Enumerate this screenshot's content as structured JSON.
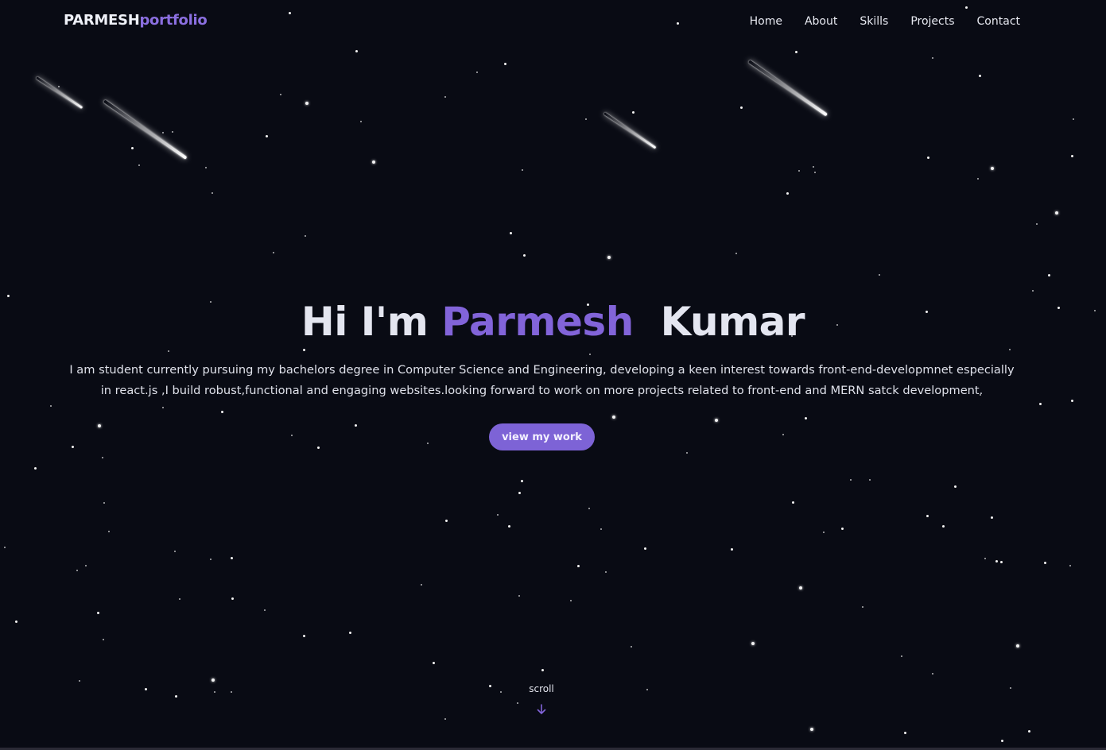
{
  "brand": {
    "part1": "PARMESH",
    "part2": "portfolio"
  },
  "nav": {
    "items": [
      {
        "label": "Home"
      },
      {
        "label": "About"
      },
      {
        "label": "Skills"
      },
      {
        "label": "Projects"
      },
      {
        "label": "Contact"
      }
    ]
  },
  "hero": {
    "greeting": "Hi I'm",
    "first_name": "Parmesh",
    "last_name": "Kumar",
    "description": "I am student currently pursuing my bachelors degree in Computer Science and Engineering, developing a keen interest towards front-end-developmnet especially in react.js ,I build robust,functional and engaging websites.looking forward to work on more projects related to front-end and MERN satck development.",
    "cta_label": "view my work"
  },
  "scroll": {
    "label": "scroll",
    "icon": "arrow-down-icon"
  },
  "colors": {
    "background": "#090b14",
    "accent": "#8264d9",
    "button": "#7d63d6",
    "text": "#e4e6f0"
  }
}
